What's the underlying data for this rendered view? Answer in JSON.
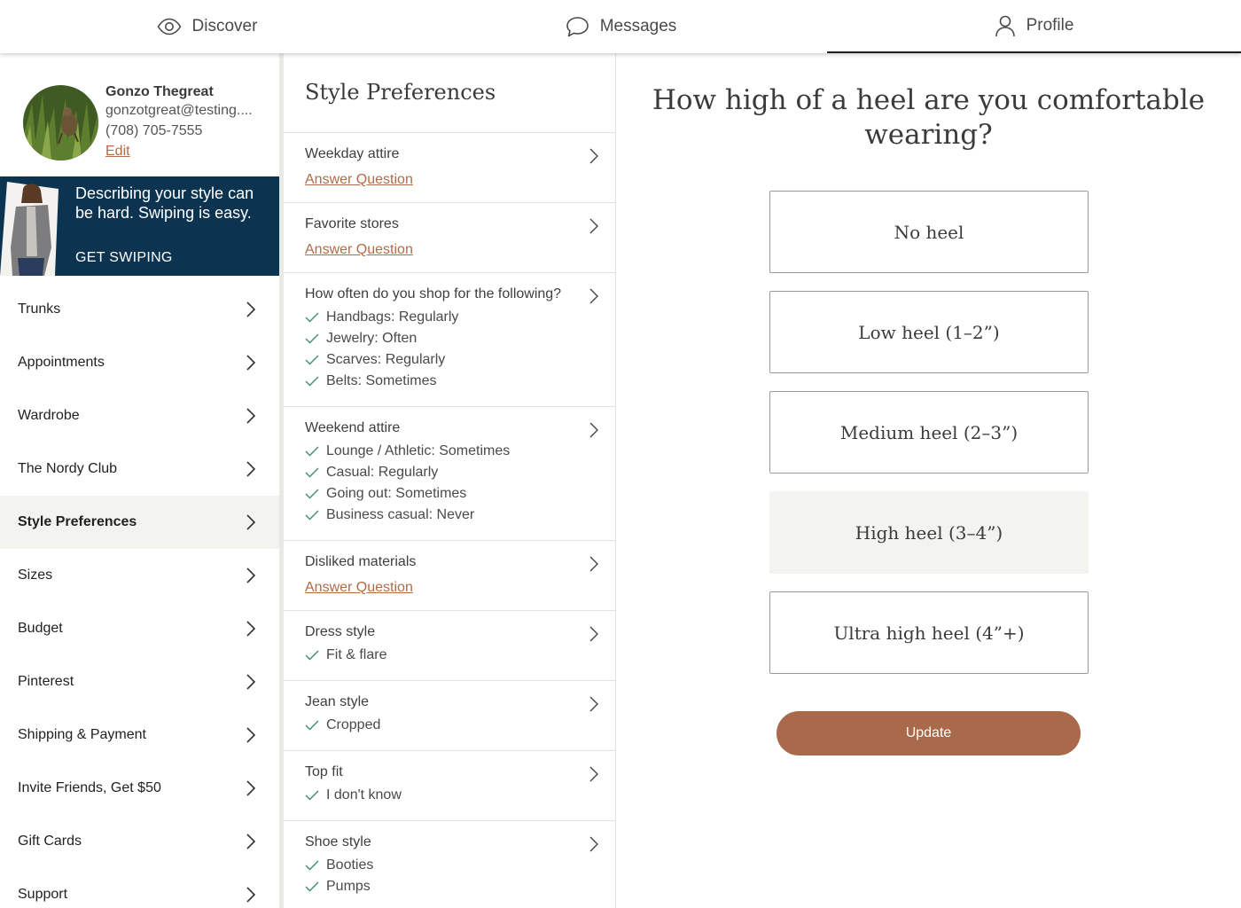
{
  "nav": {
    "tabs": [
      {
        "label": "Discover",
        "icon": "eye-icon"
      },
      {
        "label": "Messages",
        "icon": "chat-bubble-icon"
      },
      {
        "label": "Profile",
        "icon": "person-icon",
        "active": true
      }
    ]
  },
  "profile": {
    "name": "Gonzo Thegreat",
    "email": "gonzotgreat@testing....",
    "phone": "(708) 705-7555",
    "edit_label": "Edit"
  },
  "promo": {
    "text": "Describing your style can be hard. Swiping is easy.",
    "cta": "GET SWIPING"
  },
  "sidebar": {
    "items": [
      {
        "label": "Trunks"
      },
      {
        "label": "Appointments"
      },
      {
        "label": "Wardrobe"
      },
      {
        "label": "The Nordy Club"
      },
      {
        "label": "Style Preferences",
        "active": true
      },
      {
        "label": "Sizes"
      },
      {
        "label": "Budget"
      },
      {
        "label": "Pinterest"
      },
      {
        "label": "Shipping & Payment"
      },
      {
        "label": "Invite Friends, Get $50"
      },
      {
        "label": "Gift Cards"
      },
      {
        "label": "Support"
      }
    ]
  },
  "style_prefs": {
    "title": "Style Preferences",
    "answer_label": "Answer Question",
    "questions": [
      {
        "title": "Weekday attire",
        "answers": []
      },
      {
        "title": "Favorite stores",
        "answers": []
      },
      {
        "title": "How often do you shop for the following?",
        "answers": [
          "Handbags: Regularly",
          "Jewelry: Often",
          "Scarves: Regularly",
          "Belts: Sometimes"
        ]
      },
      {
        "title": "Weekend attire",
        "answers": [
          "Lounge / Athletic: Sometimes",
          "Casual: Regularly",
          "Going out: Sometimes",
          "Business casual: Never"
        ]
      },
      {
        "title": "Disliked materials",
        "answers": []
      },
      {
        "title": "Dress style",
        "answers": [
          "Fit & flare"
        ]
      },
      {
        "title": "Jean style",
        "answers": [
          "Cropped"
        ]
      },
      {
        "title": "Top fit",
        "answers": [
          "I don't know"
        ]
      },
      {
        "title": "Shoe style",
        "answers": [
          "Booties",
          "Pumps"
        ]
      }
    ]
  },
  "heel_question": {
    "question": "How high of a heel are you comfortable wearing?",
    "options": [
      {
        "label": "No heel"
      },
      {
        "label": "Low heel (1–2”)"
      },
      {
        "label": "Medium heel (2–3”)"
      },
      {
        "label": "High heel (3–4”)",
        "selected": true
      },
      {
        "label": "Ultra high heel (4”+)"
      }
    ],
    "update_label": "Update"
  },
  "colors": {
    "accent": "#a86a4b",
    "link": "#b26b47",
    "promo_bg": "#0c3450",
    "selected_bg": "#f3f3f0",
    "check": "#3d8c6e"
  }
}
